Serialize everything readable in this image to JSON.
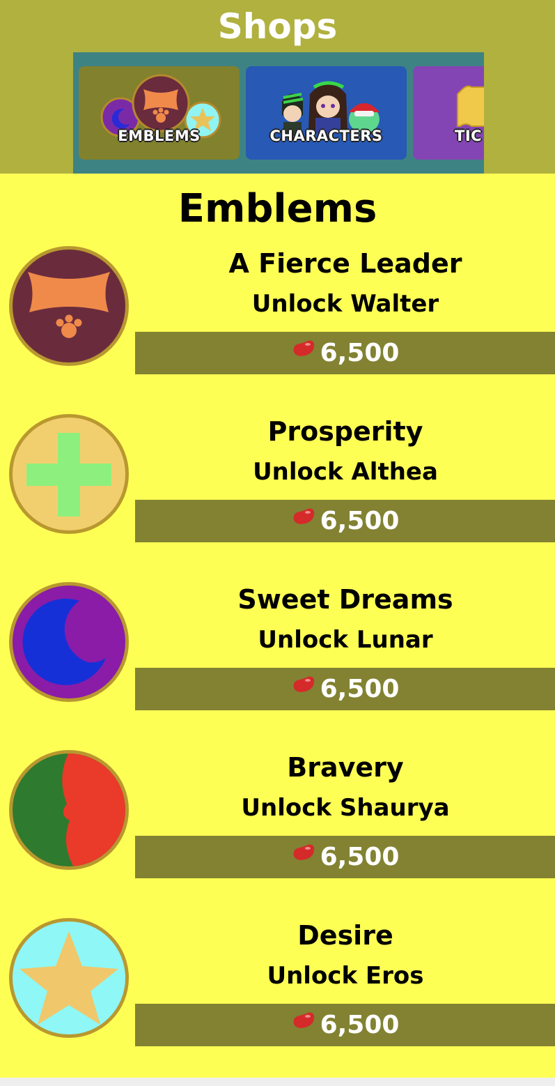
{
  "header": {
    "title": "Shops"
  },
  "tabs": [
    {
      "label": "EMBLEMS",
      "selected": true
    },
    {
      "label": "CHARACTERS",
      "selected": false
    },
    {
      "label": "TIC",
      "selected": false
    }
  ],
  "section": {
    "title": "Emblems"
  },
  "currency_icon": "jelly-bean-icon",
  "items": [
    {
      "name": "A Fierce Leader",
      "unlock": "Unlock Walter",
      "price": "6,500",
      "emblem_icon": "beard-paw-emblem-icon"
    },
    {
      "name": "Prosperity",
      "unlock": "Unlock Althea",
      "price": "6,500",
      "emblem_icon": "green-cross-emblem-icon"
    },
    {
      "name": "Sweet Dreams",
      "unlock": "Unlock Lunar",
      "price": "6,500",
      "emblem_icon": "crescent-moon-emblem-icon"
    },
    {
      "name": "Bravery",
      "unlock": "Unlock Shaurya",
      "price": "6,500",
      "emblem_icon": "red-green-split-emblem-icon"
    },
    {
      "name": "Desire",
      "unlock": "Unlock Eros",
      "price": "6,500",
      "emblem_icon": "star-emblem-icon"
    }
  ],
  "colors": {
    "header_bg": "#b0b13e",
    "page_bg": "#feff55",
    "price_bar": "#828232",
    "tab_emblems": "#81812e",
    "tab_characters": "#2759b5",
    "tab_tickets": "#8445b4"
  }
}
